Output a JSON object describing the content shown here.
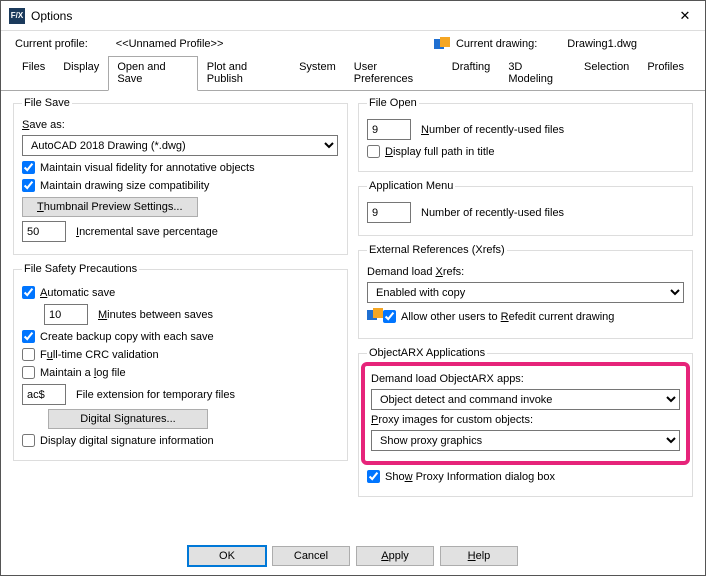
{
  "window": {
    "title": "Options"
  },
  "profile": {
    "label": "Current profile:",
    "value": "<<Unnamed Profile>>",
    "drawing_label": "Current drawing:",
    "drawing_value": "Drawing1.dwg"
  },
  "tabs": {
    "files": "Files",
    "display": "Display",
    "open_and_save": "Open and Save",
    "plot_and_publish": "Plot and Publish",
    "system": "System",
    "user_prefs": "User Preferences",
    "drafting": "Drafting",
    "three_d": "3D Modeling",
    "selection": "Selection",
    "profiles": "Profiles"
  },
  "file_save": {
    "legend": "File Save",
    "save_as_label": "Save as:",
    "save_as_value": "AutoCAD 2018 Drawing (*.dwg)",
    "maintain_visual": "Maintain visual fidelity for annotative objects",
    "maintain_drawing": "Maintain drawing size compatibility",
    "thumbnail_btn": "Thumbnail Preview Settings...",
    "incremental_value": "50",
    "incremental_label": "Incremental save percentage"
  },
  "safety": {
    "legend": "File Safety Precautions",
    "automatic_save": "Automatic save",
    "minutes_value": "10",
    "minutes_label": "Minutes between saves",
    "create_backup": "Create backup copy with each save",
    "full_crc": "Full-time CRC validation",
    "maintain_log": "Maintain a log file",
    "ext_value": "ac$",
    "ext_label": "File extension for temporary files",
    "digital_sig_btn": "Digital Signatures...",
    "display_dsig": "Display digital signature information"
  },
  "file_open": {
    "legend": "File Open",
    "recent_value": "9",
    "recent_label": "Number of recently-used files",
    "display_full_path": "Display full path in title"
  },
  "app_menu": {
    "legend": "Application Menu",
    "recent_value": "9",
    "recent_label": "Number of recently-used files"
  },
  "xrefs": {
    "legend": "External References (Xrefs)",
    "demand_label": "Demand load Xrefs:",
    "demand_value": "Enabled with copy",
    "allow_others_pre": "Allow other users to ",
    "allow_others_key": "R",
    "allow_others_post": "efedit current drawing"
  },
  "arx": {
    "legend": "ObjectARX Applications",
    "demand_label": "Demand load ObjectARX apps:",
    "demand_value": "Object detect and command invoke",
    "proxy_label": "Proxy images for custom objects:",
    "proxy_value": "Show proxy graphics",
    "show_proxy_dlg": "Show Proxy Information dialog box"
  },
  "buttons": {
    "ok": "OK",
    "cancel": "Cancel",
    "apply": "Apply",
    "help": "Help"
  },
  "underlines": {
    "S": "S",
    "T": "T",
    "I": "I",
    "A": "A",
    "M": "M",
    "u": "u",
    "l": "l",
    "N": "N",
    "D": "D",
    "X": "X",
    "w": "w",
    "P": "P",
    "H": "H"
  }
}
